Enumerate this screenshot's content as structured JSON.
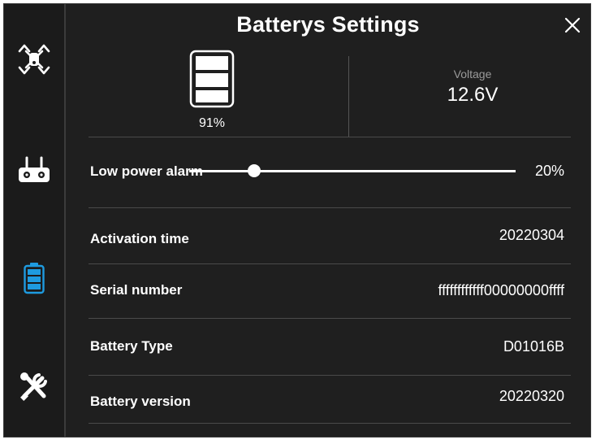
{
  "dialog": {
    "title": "Batterys Settings"
  },
  "sidebar": {
    "items": [
      {
        "icon": "drone-icon",
        "active": false
      },
      {
        "icon": "remote-controller-icon",
        "active": false
      },
      {
        "icon": "battery-icon",
        "active": true
      },
      {
        "icon": "tools-icon",
        "active": false
      }
    ],
    "active_color": "#1e9be0"
  },
  "battery": {
    "percent_label": "91%",
    "voltage_label": "Voltage",
    "voltage_value": "12.6V"
  },
  "low_power_alarm": {
    "label": "Low power alarm",
    "value_label": "20%",
    "value": 0.2
  },
  "rows": [
    {
      "label": "Activation time",
      "value": "20220304"
    },
    {
      "label": "Serial number",
      "value": "ffffffffffff00000000ffff"
    },
    {
      "label": "Battery Type",
      "value": "D01016B"
    },
    {
      "label": "Battery version",
      "value": "20220320"
    }
  ]
}
